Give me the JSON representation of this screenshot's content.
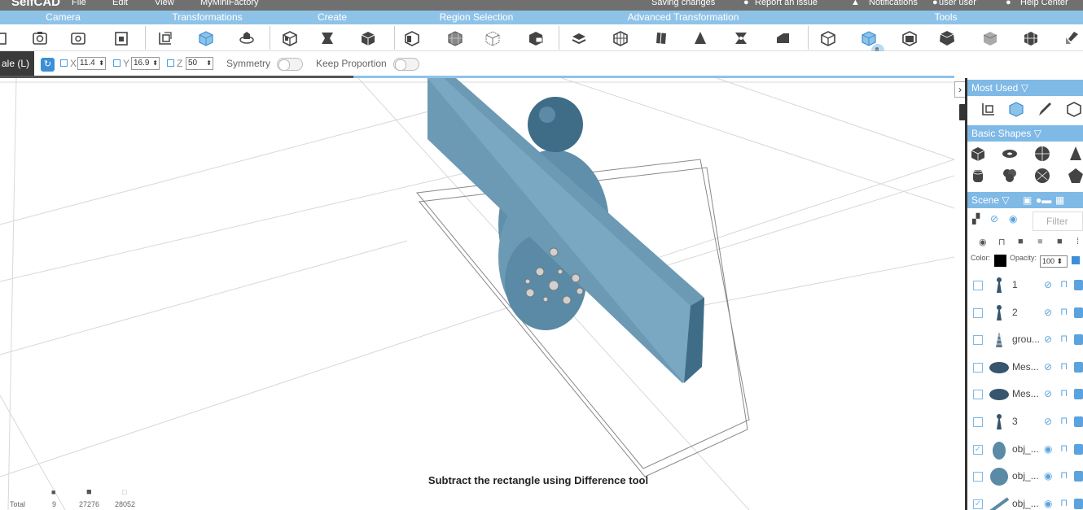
{
  "menubar": {
    "brand": "SelfCAD",
    "items": [
      "File",
      "Edit",
      "View",
      "MyMiniFactory"
    ],
    "saving": "Saving changes",
    "report": "Report an issue",
    "notifications": "Notifications",
    "user": "user user",
    "help": "Help Center"
  },
  "categories": [
    "Camera",
    "Transformations",
    "Create",
    "Region Selection",
    "Advanced Transformation",
    "Tools"
  ],
  "toolbar": {
    "icons": [
      "camera-rotate-icon",
      "camera-snapshot-icon",
      "camera-save-icon",
      "transform-scale-icon",
      "transform-cube-icon",
      "transform-rotate-icon",
      "create-box-icon",
      "create-extrude-icon",
      "create-shape-icon",
      "region-cube-icon",
      "region-grid-icon",
      "region-box-icon",
      "region-corner-icon",
      "adv-stack-icon",
      "adv-grid-icon",
      "adv-twist-icon",
      "adv-cone-icon",
      "adv-star-icon",
      "adv-bevel-icon",
      "tools-outline-icon",
      "tools-difference-icon",
      "tools-intersect-icon",
      "tools-round-icon",
      "tools-smooth-icon",
      "tools-pattern-icon",
      "tools-brush-icon"
    ],
    "active_tool": "tools-difference-icon",
    "accent_color": "#8ec3e8"
  },
  "options": {
    "mode_label": "ale (L)",
    "x_label": "X",
    "x_value": "11.4",
    "y_label": "Y",
    "y_value": "16.9",
    "z_label": "Z",
    "z_value": "50",
    "symmetry_label": "Symmetry",
    "keep_proportion_label": "Keep Proportion"
  },
  "viewport": {
    "caption": "Subtract the rectangle using Difference tool",
    "stats_labels": [
      "Total"
    ],
    "stats_values": [
      "9",
      "27276",
      "28052"
    ],
    "object_color": "#5f8fab"
  },
  "panel": {
    "most_used": "Most Used",
    "basic_shapes": "Basic Shapes",
    "scene": "Scene",
    "filter_placeholder": "Filter",
    "color_label": "Color:",
    "opacity_label": "Opacity:",
    "opacity_value": "100",
    "header_color": "#7fb9e6",
    "rows": [
      {
        "name": "1",
        "checked": false
      },
      {
        "name": "2",
        "checked": false
      },
      {
        "name": "grou...",
        "checked": false
      },
      {
        "name": "Mes...",
        "checked": false
      },
      {
        "name": "Mes...",
        "checked": false
      },
      {
        "name": "3",
        "checked": false
      },
      {
        "name": "obj_...",
        "checked": true
      },
      {
        "name": "obj_...",
        "checked": false
      },
      {
        "name": "obj_...",
        "checked": true
      }
    ]
  }
}
